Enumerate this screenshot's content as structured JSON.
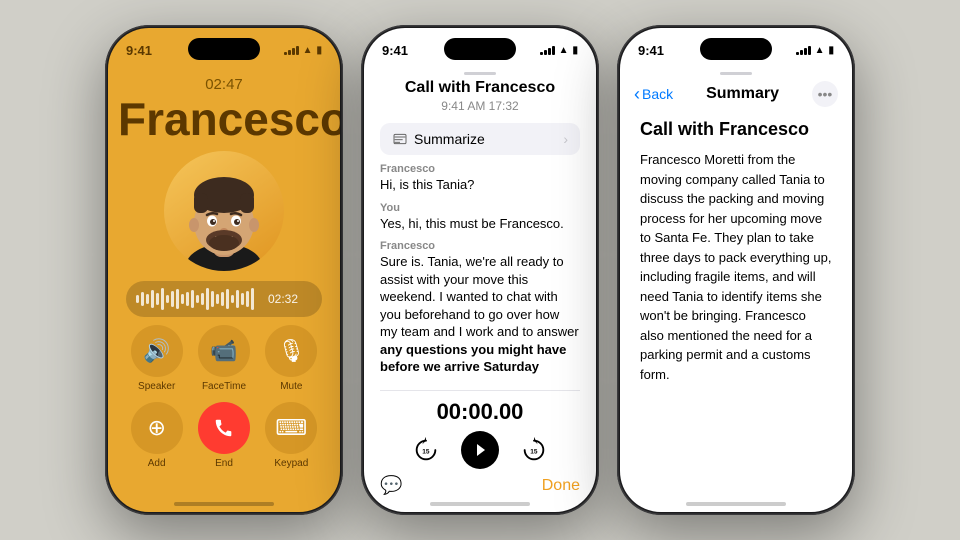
{
  "background_color": "#d0cfc8",
  "phone1": {
    "status_time": "9:41",
    "call_duration": "02:47",
    "caller_name": "Francesco",
    "recording_timer": "02:32",
    "buttons": [
      {
        "icon": "🔊",
        "label": "Speaker"
      },
      {
        "icon": "📹",
        "label": "FaceTime"
      },
      {
        "icon": "🎤",
        "label": "Mute"
      },
      {
        "icon": "👤",
        "label": "Add"
      },
      {
        "icon": "📞",
        "label": "End",
        "style": "end"
      },
      {
        "icon": "⌨️",
        "label": "Keypad"
      }
    ]
  },
  "phone2": {
    "status_time": "9:41",
    "title": "Call with Francesco",
    "subtitle": "9:41 AM  17:32",
    "summarize_label": "Summarize",
    "messages": [
      {
        "sender": "Francesco",
        "text": "Hi, is this Tania?"
      },
      {
        "sender": "You",
        "text": "Yes, hi, this must be Francesco."
      },
      {
        "sender": "Francesco",
        "text": "Sure is. Tania, we're all ready to assist with your move this weekend. I wanted to chat with you beforehand to go over how my team and I work and to answer any questions you might have before we arrive Saturday",
        "has_bold": true,
        "bold_start": 90
      }
    ],
    "playback_time": "00:00.00",
    "skip_back": "15",
    "skip_forward": "15",
    "done_label": "Done"
  },
  "phone3": {
    "status_time": "9:41",
    "back_label": "Back",
    "nav_title": "Summary",
    "call_title": "Call with Francesco",
    "summary_text": "Francesco Moretti from the moving company called Tania to discuss the packing and moving process for her upcoming move to Santa Fe. They plan to take three days to pack everything up, including fragile items, and will need Tania to identify items she won't be bringing. Francesco also mentioned the need for a parking permit and a customs form."
  }
}
